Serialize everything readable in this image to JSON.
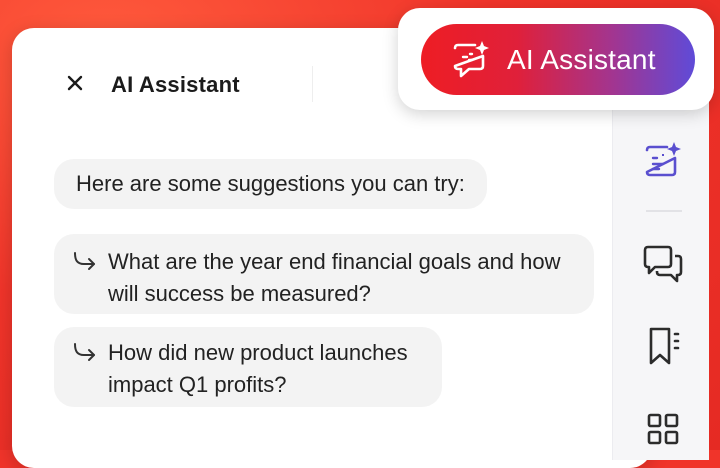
{
  "header": {
    "title": "AI Assistant",
    "close_icon": "close-icon"
  },
  "conversation": {
    "intro": "Here are some suggestions you can try:",
    "suggestions": [
      {
        "text": "What are the year end financial goals and how\nwill success be measured?",
        "icon": "arrow-return-icon"
      },
      {
        "text": "How did new product launches\nimpact Q1 profits?",
        "icon": "arrow-return-icon"
      }
    ]
  },
  "ai_button": {
    "label": "AI Assistant",
    "icon": "ai-chat-sparkle-icon",
    "gradient_start": "#ee1d24",
    "gradient_end": "#5f4bd8"
  },
  "rail": {
    "items": [
      {
        "icon": "ai-document-sparkle-icon",
        "active": true,
        "color": "#5a4fcf"
      },
      {
        "icon": "comments-icon",
        "active": false,
        "color": "#2c2c2c"
      },
      {
        "icon": "bookmarks-icon",
        "active": false,
        "color": "#2c2c2c"
      },
      {
        "icon": "thumbnails-grid-icon",
        "active": false,
        "color": "#2c2c2c"
      }
    ]
  },
  "colors": {
    "background": "#f0342a",
    "accent": "#5a4fcf"
  }
}
